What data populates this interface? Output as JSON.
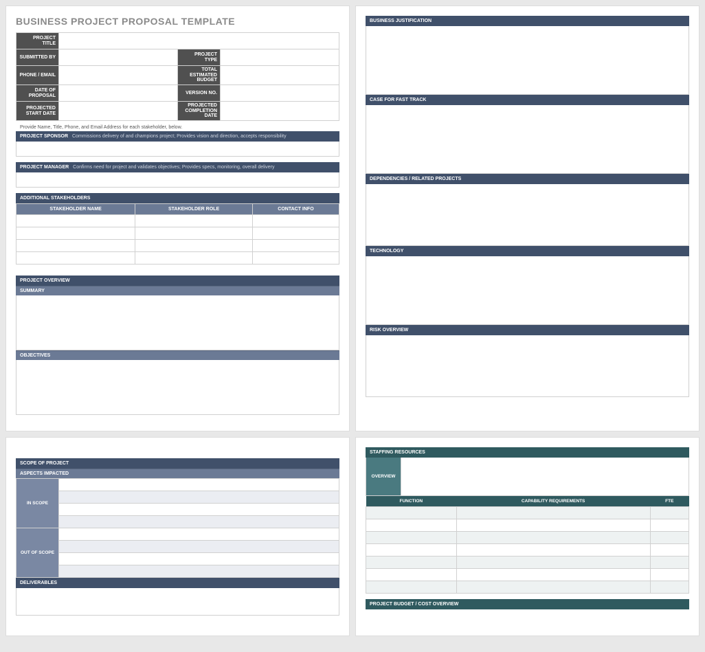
{
  "page1": {
    "title": "BUSINESS PROJECT PROPOSAL TEMPLATE",
    "info": {
      "project_title": "PROJECT TITLE",
      "submitted_by": "SUBMITTED BY",
      "project_type": "PROJECT TYPE",
      "phone_email": "PHONE / EMAIL",
      "total_budget": "TOTAL ESTIMATED BUDGET",
      "date_of_proposal": "DATE OF PROPOSAL",
      "version_no": "VERSION NO.",
      "proj_start": "PROJECTED START DATE",
      "proj_end": "PROJECTED COMPLETION DATE"
    },
    "note": "Provide Name, Title, Phone, and Email Address for each stakeholder, below.",
    "sponsor_label": "PROJECT SPONSOR",
    "sponsor_sub": "Commissions delivery of and champions project; Provides vision and direction, accepts responsibility",
    "manager_label": "PROJECT MANAGER",
    "manager_sub": "Confirms need for project and validates objectives; Provides specs, monitoring, overall delivery",
    "additional_stakeholders": "ADDITIONAL STAKEHOLDERS",
    "cols": {
      "name": "STAKEHOLDER NAME",
      "role": "STAKEHOLDER ROLE",
      "contact": "CONTACT INFO"
    },
    "overview": "PROJECT OVERVIEW",
    "summary": "SUMMARY",
    "objectives": "OBJECTIVES"
  },
  "page2": {
    "biz_just": "BUSINESS JUSTIFICATION",
    "fast_track": "CASE FOR FAST TRACK",
    "deps": "DEPENDENCIES / RELATED PROJECTS",
    "tech": "TECHNOLOGY",
    "risk": "RISK OVERVIEW"
  },
  "page3": {
    "scope": "SCOPE OF PROJECT",
    "aspects": "ASPECTS IMPACTED",
    "in_scope": "IN SCOPE",
    "out_scope": "OUT OF SCOPE",
    "deliverables": "DELIVERABLES"
  },
  "page4": {
    "staffing": "STAFFING RESOURCES",
    "overview": "OVERVIEW",
    "cols": {
      "function": "FUNCTION",
      "cap": "CAPABILITY REQUIREMENTS",
      "fte": "FTE"
    },
    "budget": "PROJECT BUDGET / COST OVERVIEW"
  }
}
